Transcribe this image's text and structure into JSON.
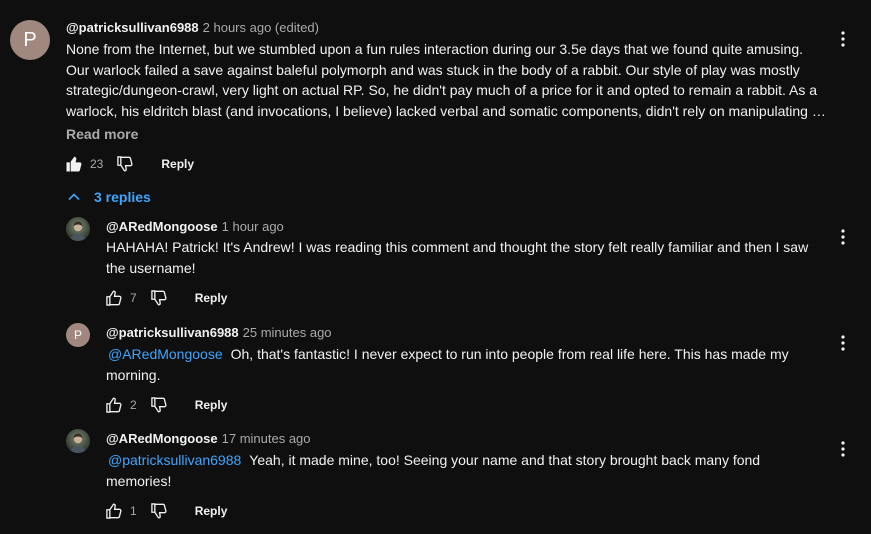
{
  "top_comment": {
    "avatar_letter": "P",
    "author": "@patricksullivan6988",
    "time": "2 hours ago (edited)",
    "lines": [
      "None from the Internet, but we stumbled upon a fun rules interaction during our 3.5e days that we found quite amusing.",
      "Our warlock failed a save against baleful polymorph and was stuck in the body of a rabbit. Our style of play was mostly",
      "strategic/dungeon-crawl, very light on actual RP. So, he didn't pay much of a price for it and opted to remain a rabbit. As a",
      "warlock, his eldritch blast (and invocations, I believe) lacked verbal and somatic components, didn't rely on manipulating …"
    ],
    "read_more": "Read more",
    "likes": "23",
    "reply_label": "Reply"
  },
  "replies_toggle": "3 replies",
  "replies": [
    {
      "author": "@ARedMongoose",
      "time": "1 hour ago",
      "mention": "",
      "lines": [
        "HAHAHA! Patrick! It's Andrew! I was reading this comment and thought the story felt really familiar and then I saw",
        "the username!"
      ],
      "likes": "7",
      "reply_label": "Reply"
    },
    {
      "avatar_letter": "P",
      "author": "@patricksullivan6988",
      "time": "25 minutes ago",
      "mention": "@ARedMongoose",
      "line1_rest": "Oh, that's fantastic! I never expect to run into people from real life here. This has made my",
      "line2": "morning.",
      "likes": "2",
      "reply_label": "Reply"
    },
    {
      "author": "@ARedMongoose",
      "time": "17 minutes ago",
      "mention": "@patricksullivan6988",
      "line1_rest": "Yeah, it made mine, too! Seeing your name and that story brought back many fond",
      "line2": "memories!",
      "likes": "1",
      "reply_label": "Reply"
    }
  ],
  "icons": {
    "like": "thumbs-up-icon",
    "dislike": "thumbs-down-icon",
    "menu": "more-vert-icon",
    "chevron": "chevron-up-icon"
  },
  "colors": {
    "background": "#0f0f0f",
    "text": "#f1f1f1",
    "secondary": "#aaaaaa",
    "link": "#3ea6ff",
    "avatar": "#a1887f"
  }
}
